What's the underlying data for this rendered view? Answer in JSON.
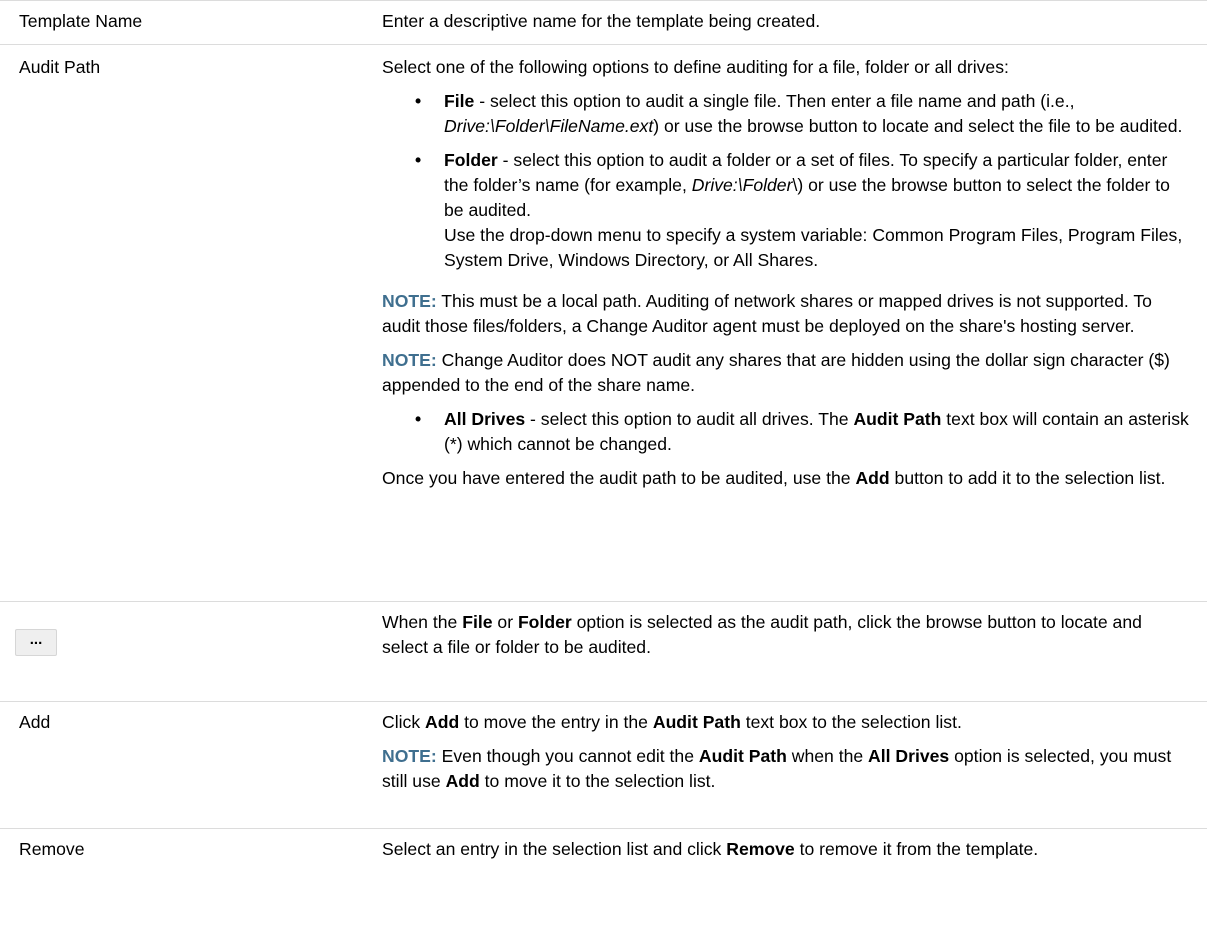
{
  "rows": {
    "template_name": {
      "term": "Template Name",
      "desc": "Enter a descriptive name for the template being created."
    },
    "audit_path": {
      "term": "Audit Path",
      "intro": "Select one of the following options to define auditing for a file, folder or all drives:",
      "file_opt": {
        "label": "File",
        "t1": " - select this option to audit a single file. Then enter a file name and path (i.e., ",
        "path": "Drive:\\Folder\\FileName.ext",
        "t2": ") or use the browse button to locate and select the file to be audited."
      },
      "folder_opt": {
        "label": "Folder",
        "t1": " - select this option to audit a folder or a set of files. To specify a particular folder, enter the folder’s name (for example, ",
        "path": "Drive:\\Folder",
        "t2": "\\) or use the browse button to select the folder to be audited."
      },
      "dropdown_text": "Use the drop-down menu to specify a system variable: Common Program Files, Program Files, System Drive, Windows Directory, or All Shares.",
      "note1_label": "NOTE:",
      "note1_text": " This must be a local path. Auditing of network shares or mapped drives is not supported. To audit those files/folders, a Change Auditor agent must be deployed on the share's hosting server.",
      "note2_label": "NOTE:",
      "note2_text": " Change Auditor does NOT audit any shares that are hidden using the dollar sign character ($) appended to the end of the share name.",
      "alldrives_opt": {
        "label": "All Drives",
        "t1": " - select this option to audit all drives. The ",
        "b1": "Audit Path",
        "t2": " text box will contain an asterisk (*) which cannot be changed."
      },
      "closing": {
        "t1": "Once you have entered the audit path to be audited, use the ",
        "b1": "Add",
        "t2": " button to add it to the selection list."
      }
    },
    "browse": {
      "button_label": "...",
      "t1": "When the ",
      "b1": "File",
      "t2": " or ",
      "b2": "Folder",
      "t3": " option is selected as the audit path, click the browse button to locate and select a file or folder to be audited."
    },
    "add": {
      "term": "Add",
      "t1": "Click ",
      "b1": "Add",
      "t2": " to move the entry in the ",
      "b2": "Audit Path",
      "t3": " text box to the selection list.",
      "note_label": "NOTE:",
      "n1": " Even though you cannot edit the ",
      "nb1": "Audit Path",
      "n2": " when the ",
      "nb2": "All Drives",
      "n3": " option is selected, you must still use ",
      "nb3": "Add",
      "n4": " to move it to the selection list."
    },
    "remove": {
      "term": "Remove",
      "t1": "Select an entry in the selection list and click ",
      "b1": "Remove",
      "t2": " to remove it from the template."
    }
  },
  "bullet_char": "•"
}
